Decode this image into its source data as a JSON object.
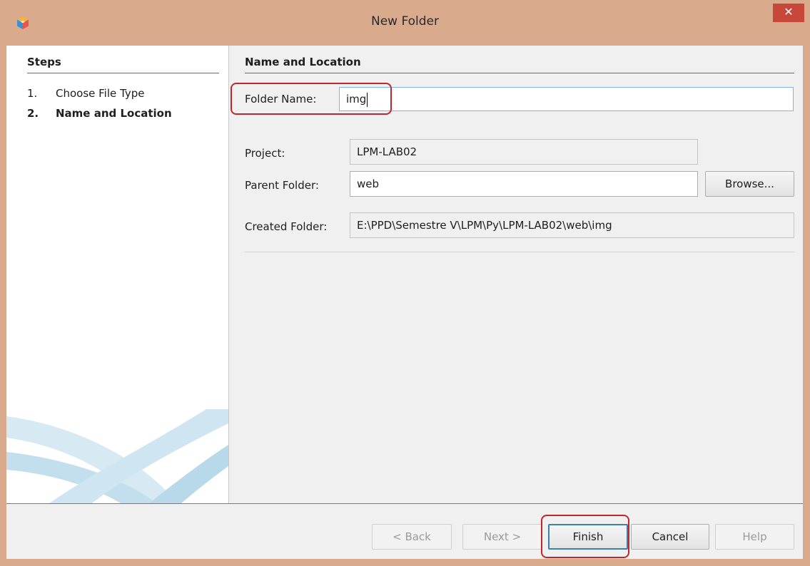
{
  "window": {
    "title": "New Folder",
    "close_glyph": "✕",
    "icon": "app-cube-icon"
  },
  "steps": {
    "heading": "Steps",
    "items": [
      {
        "num": "1.",
        "label": "Choose File Type",
        "active": false
      },
      {
        "num": "2.",
        "label": "Name and Location",
        "active": true
      }
    ]
  },
  "content": {
    "heading": "Name and Location",
    "folder_name": {
      "label": "Folder Name:",
      "value": "img"
    },
    "project": {
      "label": "Project:",
      "value": "LPM-LAB02"
    },
    "parent_folder": {
      "label": "Parent Folder:",
      "value": "web",
      "browse_label": "Browse..."
    },
    "created_folder": {
      "label": "Created Folder:",
      "value": "E:\\PPD\\Semestre V\\LPM\\Py\\LPM-LAB02\\web\\img"
    }
  },
  "buttons": {
    "back": "< Back",
    "next": "Next >",
    "finish": "Finish",
    "cancel": "Cancel",
    "help": "Help"
  },
  "colors": {
    "titlebar": "#d9aa8c",
    "close": "#c7473b",
    "highlight": "#c0262c",
    "default_button_border": "#3c7fb1"
  }
}
